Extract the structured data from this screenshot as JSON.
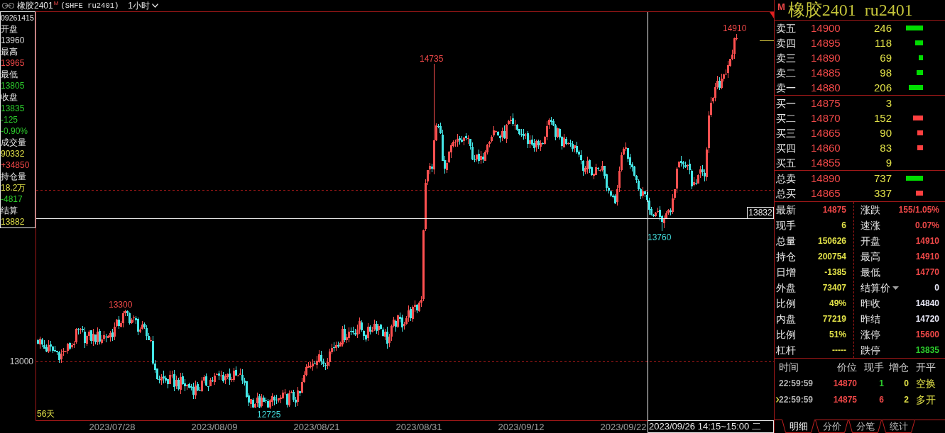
{
  "title_bar": {
    "symbol": "橡胶2401",
    "marker": "M",
    "code": "(SHFE ru2401)",
    "period": "1小时"
  },
  "info_panel": {
    "time": "09261415",
    "fields": [
      {
        "label": "开盘",
        "values": [
          {
            "text": "13960",
            "color": "#d8d8d8"
          }
        ]
      },
      {
        "label": "最高",
        "values": [
          {
            "text": "13965",
            "color": "#f04848"
          }
        ]
      },
      {
        "label": "最低",
        "values": [
          {
            "text": "13805",
            "color": "#2ccc2c"
          }
        ]
      },
      {
        "label": "收盘",
        "values": [
          {
            "text": "13835",
            "color": "#2ccc2c"
          },
          {
            "text": "-125",
            "color": "#2ccc2c"
          },
          {
            "text": "-0.90%",
            "color": "#2ccc2c"
          }
        ]
      },
      {
        "label": "成交量",
        "values": [
          {
            "text": "90332",
            "color": "#e0e048"
          },
          {
            "text": "+34850",
            "color": "#f04848"
          }
        ]
      },
      {
        "label": "持仓量",
        "values": [
          {
            "text": "18.2万",
            "color": "#e0e048"
          },
          {
            "text": "-4817",
            "color": "#2ccc2c"
          }
        ]
      },
      {
        "label": "结算",
        "values": [
          {
            "text": "13882",
            "color": "#e0e048"
          }
        ]
      }
    ]
  },
  "chart": {
    "price_axis_label": "13000",
    "annotations": [
      {
        "text": "13300",
        "kind": "high"
      },
      {
        "text": "12725",
        "kind": "low"
      },
      {
        "text": "14735",
        "kind": "high"
      },
      {
        "text": "13760",
        "kind": "low"
      },
      {
        "text": "14910",
        "kind": "high"
      }
    ],
    "range": "56天",
    "cursor": {
      "price": "13832",
      "time": "2023/09/26 14:15~15:00 二"
    },
    "dates": [
      "2023/07/28",
      "2023/08/09",
      "2023/08/21",
      "2023/08/31",
      "2023/09/12",
      "2023/09/22"
    ]
  },
  "quote_header": {
    "marker": "M",
    "title": "橡胶2401 ru2401"
  },
  "order_book": {
    "asks": [
      {
        "label": "卖五",
        "price": "14900",
        "volume": "246",
        "color": "#00dd00"
      },
      {
        "label": "卖四",
        "price": "14895",
        "volume": "118",
        "color": "#00dd00"
      },
      {
        "label": "卖三",
        "price": "14890",
        "volume": "69",
        "color": "#00dd00"
      },
      {
        "label": "卖二",
        "price": "14885",
        "volume": "98",
        "color": "#00dd00"
      },
      {
        "label": "卖一",
        "price": "14880",
        "volume": "206",
        "color": "#00dd00"
      }
    ],
    "bids": [
      {
        "label": "买一",
        "price": "14875",
        "volume": "3"
      },
      {
        "label": "买二",
        "price": "14870",
        "volume": "152",
        "color": "#ff4040"
      },
      {
        "label": "买三",
        "price": "14865",
        "volume": "90",
        "color": "#ff4040"
      },
      {
        "label": "买四",
        "price": "14860",
        "volume": "83",
        "color": "#ff4040"
      },
      {
        "label": "买五",
        "price": "14855",
        "volume": "9"
      }
    ],
    "totals": [
      {
        "label": "总卖",
        "price": "14890",
        "volume": "737",
        "color": "#00dd00"
      },
      {
        "label": "总买",
        "price": "14865",
        "volume": "337",
        "color": "#ff4040"
      }
    ]
  },
  "stats": {
    "left": [
      {
        "label": "最新",
        "value": "14875",
        "color": "#f04848"
      },
      {
        "label": "现手",
        "value": "6",
        "color": "#e0e048"
      },
      {
        "label": "总量",
        "value": "150626",
        "color": "#e0e048"
      },
      {
        "label": "持仓",
        "value": "200754",
        "color": "#e0e048"
      },
      {
        "label": "日增",
        "value": "-1385",
        "color": "#e0e048"
      },
      {
        "label": "外盘",
        "value": "73407",
        "color": "#e0e048"
      },
      {
        "label": "比例",
        "value": "49%",
        "color": "#e0e048"
      },
      {
        "label": "内盘",
        "value": "77219",
        "color": "#e0e048"
      },
      {
        "label": "比例",
        "value": "51%",
        "color": "#e0e048"
      },
      {
        "label": "杠杆",
        "value": "-----",
        "color": "#e0e048"
      }
    ],
    "right": [
      {
        "label": "涨跌",
        "value": "155/1.05%",
        "color": "#f04848"
      },
      {
        "label": "速涨",
        "value": "0.07%",
        "color": "#f04848"
      },
      {
        "label": "开盘",
        "value": "14910",
        "color": "#f04848"
      },
      {
        "label": "最高",
        "value": "14910",
        "color": "#f04848"
      },
      {
        "label": "最低",
        "value": "14770",
        "color": "#f04848"
      },
      {
        "label": "结算价",
        "value": "0",
        "color": "#e6e6f5",
        "dropdown": true
      },
      {
        "label": "昨收",
        "value": "14840",
        "color": "#e6e6f5"
      },
      {
        "label": "昨结",
        "value": "14720",
        "color": "#e6e6f5"
      },
      {
        "label": "涨停",
        "value": "15600",
        "color": "#f04848"
      },
      {
        "label": "跌停",
        "value": "13835",
        "color": "#2ccc2c"
      }
    ]
  },
  "trades": {
    "columns": [
      "时间",
      "价位",
      "现手",
      "增仓",
      "开平"
    ],
    "rows": [
      {
        "time": "22:59:59",
        "price": "14870",
        "volume": "1",
        "color": "#2ccc2c",
        "change": "0",
        "action": "空换",
        "selected": false
      },
      {
        "time": "22:59:59",
        "price": "14875",
        "volume": "6",
        "color": "#f04848",
        "change": "2",
        "action": "多开",
        "selected": true
      }
    ]
  },
  "tabs": [
    {
      "label": "明细",
      "selected": true
    },
    {
      "label": "分价",
      "selected": false
    },
    {
      "label": "分笔",
      "selected": false
    },
    {
      "label": "统计",
      "selected": false
    }
  ]
}
